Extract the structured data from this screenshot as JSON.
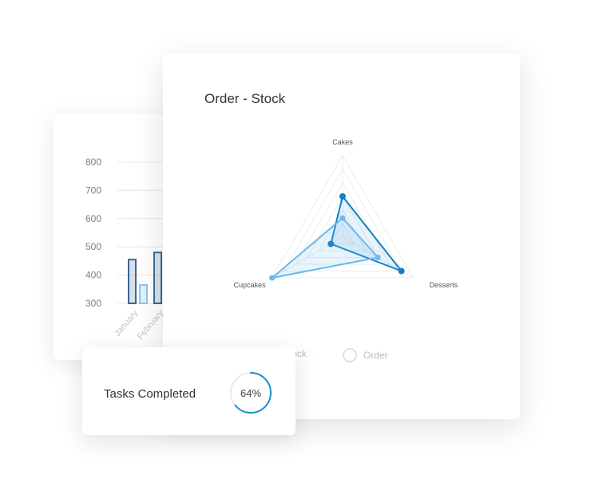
{
  "bar_card": {
    "y_ticks": [
      "800",
      "700",
      "600",
      "500",
      "400",
      "300"
    ],
    "x_labels": [
      "January",
      "February"
    ]
  },
  "radar_card": {
    "title": "Order - Stock",
    "legend": {
      "stock_label": "Stock",
      "order_label": "Order"
    }
  },
  "tasks_card": {
    "label": "Tasks Completed",
    "value_text": "64%",
    "progress": 0.64
  },
  "colors": {
    "order_line": "#1380c4",
    "stock_line": "#6ab8ee",
    "bar_dark": "#3d6794",
    "bar_light": "#8fc5e8",
    "grid": "#e9ebef",
    "ring": "#1a8dcc"
  },
  "chart_data": [
    {
      "type": "radar",
      "title": "Order - Stock",
      "categories": [
        "Cakes",
        "Desserts",
        "Cupcakes"
      ],
      "series": [
        {
          "name": "Order",
          "values": [
            60,
            100,
            20
          ]
        },
        {
          "name": "Stock",
          "values": [
            28,
            60,
            120
          ]
        }
      ],
      "range": [
        0,
        120
      ],
      "legend": "bottom"
    },
    {
      "type": "bar",
      "categories": [
        "January",
        "February"
      ],
      "series": [
        {
          "values": [
            455,
            480
          ]
        },
        {
          "values": [
            365,
            null
          ]
        }
      ],
      "ylim": [
        300,
        800
      ],
      "y_ticks": [
        800,
        700,
        600,
        500,
        400,
        300
      ]
    }
  ]
}
